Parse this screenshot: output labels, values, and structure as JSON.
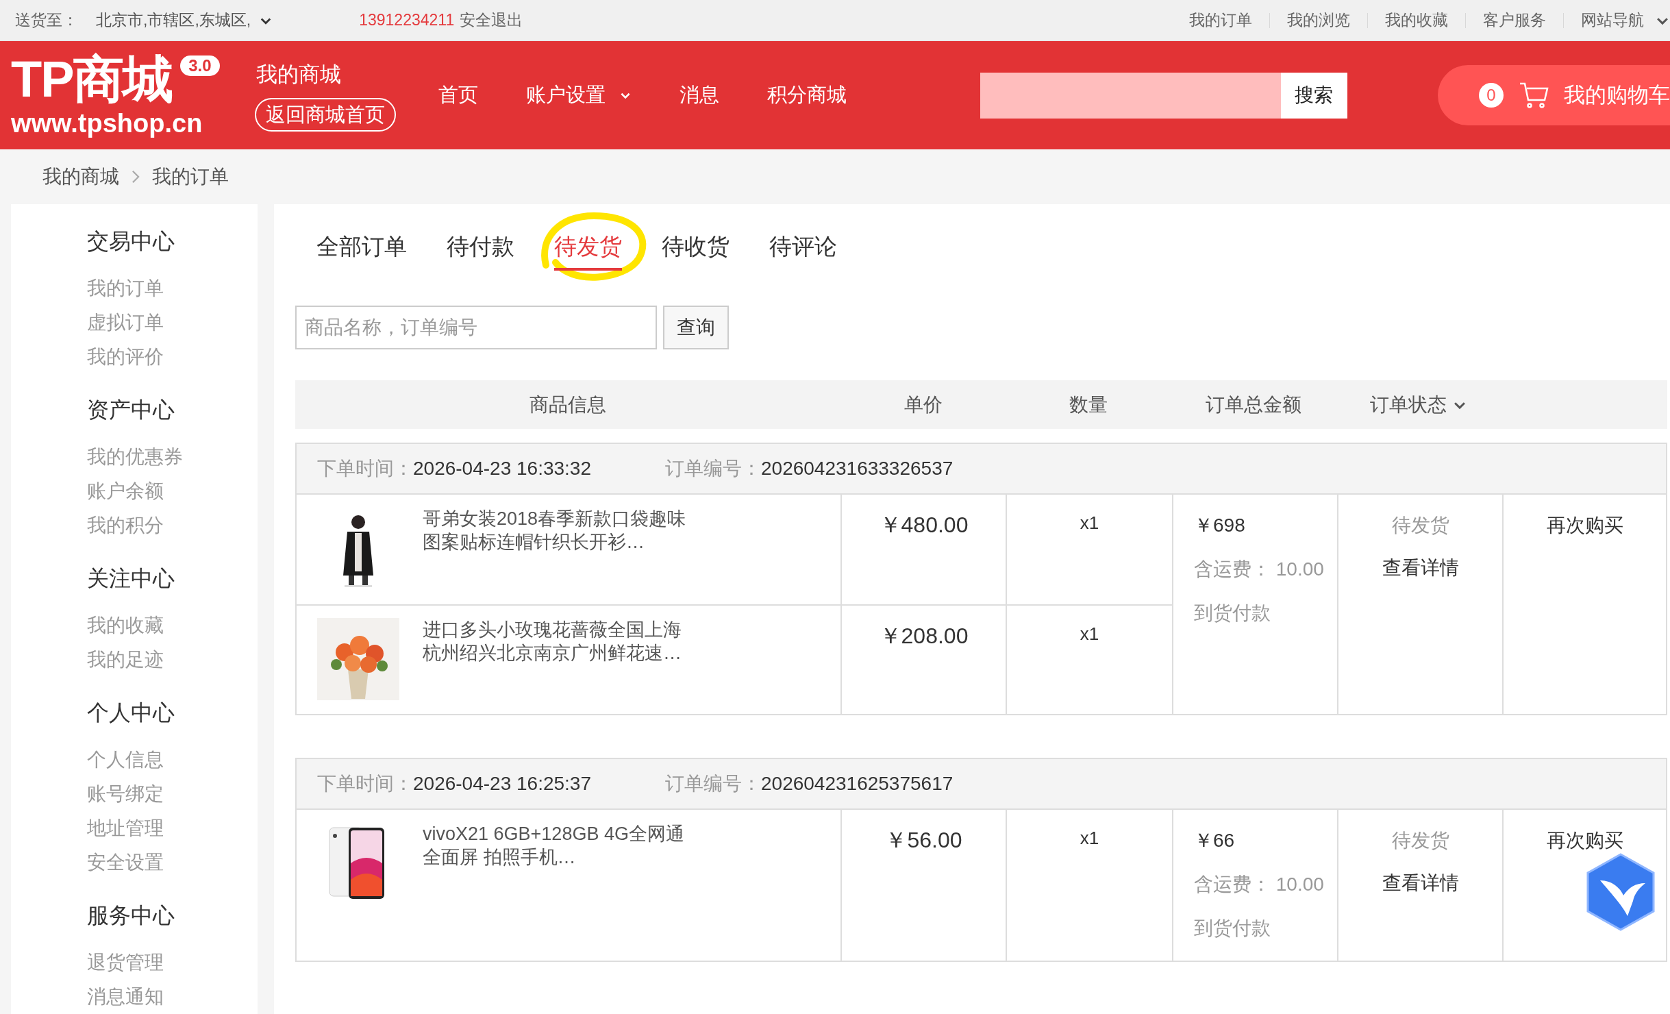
{
  "topbar": {
    "deliver_label": "送货至：",
    "location": "北京市,市辖区,东城区,",
    "phone": "13912234211",
    "logout": "安全退出",
    "links": [
      {
        "label": "我的订单",
        "dropdown": false
      },
      {
        "label": "我的浏览",
        "dropdown": false
      },
      {
        "label": "我的收藏",
        "dropdown": false
      },
      {
        "label": "客户服务",
        "dropdown": false
      },
      {
        "label": "网站导航",
        "dropdown": true
      }
    ]
  },
  "header": {
    "logo": {
      "title": "TP商城",
      "version": "3.0",
      "url": "www.tpshop.cn"
    },
    "my_mall": "我的商城",
    "back_home": "返回商城首页",
    "nav": [
      {
        "label": "首页",
        "dropdown": false
      },
      {
        "label": "账户设置",
        "dropdown": true
      },
      {
        "label": "消息",
        "dropdown": false
      },
      {
        "label": "积分商城",
        "dropdown": false
      }
    ],
    "search": {
      "button": "搜索"
    },
    "cart": {
      "count": "0",
      "label": "我的购物车"
    }
  },
  "breadcrumb": [
    "我的商城",
    "我的订单"
  ],
  "sidebar": {
    "sections": [
      {
        "title": "交易中心",
        "items": [
          "我的订单",
          "虚拟订单",
          "我的评价"
        ]
      },
      {
        "title": "资产中心",
        "items": [
          "我的优惠券",
          "账户余额",
          "我的积分"
        ]
      },
      {
        "title": "关注中心",
        "items": [
          "我的收藏",
          "我的足迹"
        ]
      },
      {
        "title": "个人中心",
        "items": [
          "个人信息",
          "账号绑定",
          "地址管理",
          "安全设置"
        ]
      },
      {
        "title": "服务中心",
        "items": [
          "退货管理",
          "消息通知"
        ]
      }
    ]
  },
  "tabs": [
    {
      "label": "全部订单",
      "selected": false
    },
    {
      "label": "待付款",
      "selected": false
    },
    {
      "label": "待发货",
      "selected": true
    },
    {
      "label": "待收货",
      "selected": false
    },
    {
      "label": "待评论",
      "selected": false
    }
  ],
  "order_search": {
    "placeholder": "商品名称，订单编号",
    "button": "查询"
  },
  "table": {
    "columns": [
      {
        "label": "商品信息",
        "dropdown": false
      },
      {
        "label": "单价",
        "dropdown": false
      },
      {
        "label": "数量",
        "dropdown": false
      },
      {
        "label": "订单总金额",
        "dropdown": false
      },
      {
        "label": "订单状态",
        "dropdown": true
      }
    ]
  },
  "orders": [
    {
      "time_label": "下单时间：",
      "time": "2026-04-23 16:33:32",
      "number_label": "订单编号：",
      "number": "202604231633326537",
      "items": [
        {
          "kind": "coat",
          "name_lines": [
            "哥弟女装2018春季新款口袋趣味",
            "图案贴标连帽针织长开衫…"
          ],
          "price": "￥480.00",
          "qty": "x1"
        },
        {
          "kind": "flowers",
          "name_lines": [
            "进口多头小玫瑰花蔷薇全国上海",
            "杭州绍兴北京南京广州鲜花速…"
          ],
          "price": "￥208.00",
          "qty": "x1"
        }
      ],
      "total": "￥698",
      "shipping_label": "含运费：",
      "shipping": "10.00",
      "payment": "到货付款",
      "status": "待发货",
      "detail": "查看详情",
      "action": "再次购买"
    },
    {
      "time_label": "下单时间：",
      "time": "2026-04-23 16:25:37",
      "number_label": "订单编号：",
      "number": "202604231625375617",
      "items": [
        {
          "kind": "phone",
          "name_lines": [
            "vivoX21 6GB+128GB 4G全网通",
            "全面屏 拍照手机…"
          ],
          "price": "￥56.00",
          "qty": "x1"
        }
      ],
      "total": "￥66",
      "shipping_label": "含运费：",
      "shipping": "10.00",
      "payment": "到货付款",
      "status": "待发货",
      "detail": "查看详情",
      "action": "再次购买"
    }
  ]
}
